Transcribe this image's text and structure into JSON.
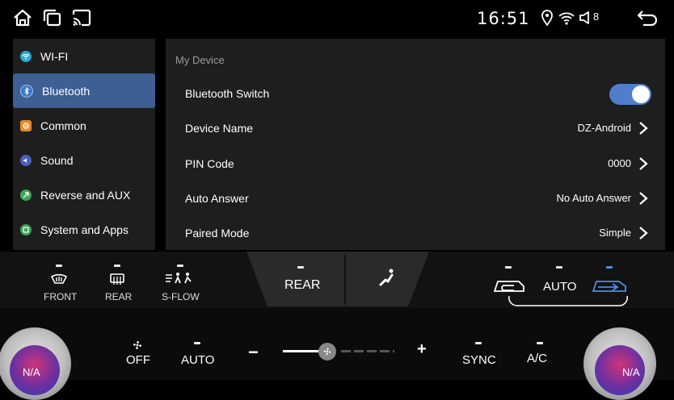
{
  "status": {
    "time": "16:51",
    "wifi_count": "8"
  },
  "sidebar": {
    "items": [
      {
        "label": "WI-FI",
        "icon": "wifi-icon",
        "color": "#27a8d8"
      },
      {
        "label": "Bluetooth",
        "icon": "bluetooth-icon",
        "color": "#3f78c9"
      },
      {
        "label": "Common",
        "icon": "gear-icon",
        "color": "#e88a2a"
      },
      {
        "label": "Sound",
        "icon": "speaker-icon",
        "color": "#4a5fc0"
      },
      {
        "label": "Reverse and AUX",
        "icon": "reverse-icon",
        "color": "#3ea55a"
      },
      {
        "label": "System and Apps",
        "icon": "apps-icon",
        "color": "#3ea55a"
      }
    ]
  },
  "content": {
    "section_title": "My Device",
    "rows": [
      {
        "label": "Bluetooth Switch",
        "value": ""
      },
      {
        "label": "Device Name",
        "value": "DZ-Android"
      },
      {
        "label": "PIN Code",
        "value": "0000"
      },
      {
        "label": "Auto Answer",
        "value": "No Auto Answer"
      },
      {
        "label": "Paired Mode",
        "value": "Simple"
      }
    ],
    "bluetooth_switch_on": true
  },
  "climate": {
    "front": "FRONT",
    "rear_defrost": "REAR",
    "sflow": "S-FLOW",
    "rear_mode": "REAR",
    "auto_recirc": "AUTO",
    "fan_off": "OFF",
    "fan_auto": "AUTO",
    "minus": "−",
    "plus": "+",
    "sync": "SYNC",
    "ac": "A/C",
    "temp_left": "N/A",
    "temp_right": "N/A",
    "fan_level": 0.45
  },
  "colors": {
    "accent": "#3d5f93",
    "toggle": "#4f7fcc",
    "active_blue": "#4a8ee6"
  }
}
